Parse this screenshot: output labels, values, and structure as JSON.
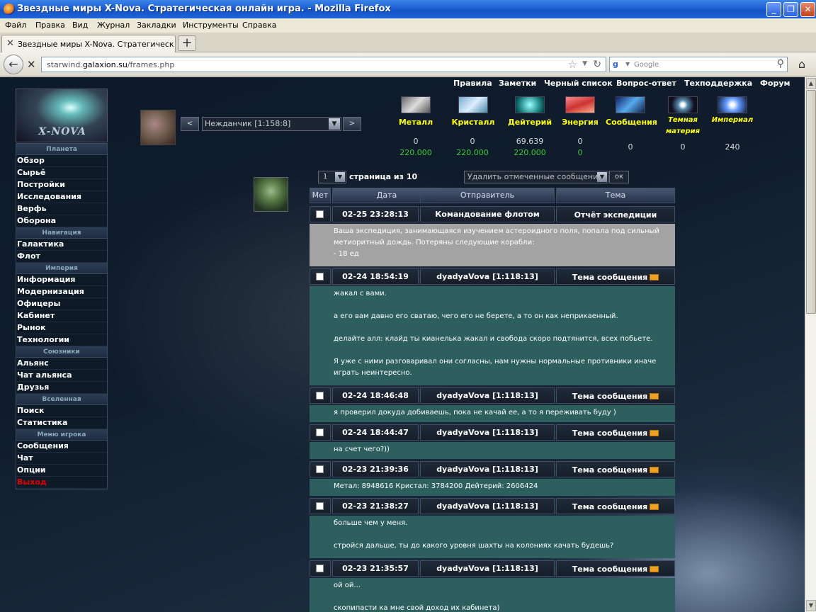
{
  "window": {
    "title": "Звездные миры X-Nova. Стратегическая онлайн игра. - Mozilla Firefox"
  },
  "menu": [
    "Файл",
    "Правка",
    "Вид",
    "Журнал",
    "Закладки",
    "Инструменты",
    "Справка"
  ],
  "tab": {
    "label": "Звездные миры X-Nova. Стратегическая ..."
  },
  "nav": {
    "url_prefix": "starwind.",
    "url_domain": "galaxion.su",
    "url_path": "/frames.php",
    "search_placeholder": "Google"
  },
  "toplinks": [
    "Правила",
    "Заметки",
    "Черный список",
    "Вопрос-ответ",
    "Техподдержка",
    "Форум"
  ],
  "planet": {
    "name": "Нежданчик [1:158:8]",
    "prev": "<",
    "next": ">"
  },
  "resources": [
    {
      "name": "Металл",
      "current": "0",
      "production": "220.000"
    },
    {
      "name": "Кристалл",
      "current": "0",
      "production": "220.000"
    },
    {
      "name": "Дейтерий",
      "current": "69.639",
      "production": "220.000"
    },
    {
      "name": "Энергия",
      "current": "0",
      "production": "0"
    },
    {
      "name": "Сообщения",
      "current": "0",
      "production": ""
    },
    {
      "name": "Темная материя",
      "current": "0",
      "production": ""
    },
    {
      "name": "Империал",
      "current": "240",
      "production": ""
    }
  ],
  "leftmenu": [
    {
      "type": "section",
      "label": "Планета"
    },
    {
      "type": "item",
      "label": "Обзор"
    },
    {
      "type": "item",
      "label": "Сырьё"
    },
    {
      "type": "item",
      "label": "Постройки"
    },
    {
      "type": "item",
      "label": "Исследования"
    },
    {
      "type": "item",
      "label": "Верфь"
    },
    {
      "type": "item",
      "label": "Оборона"
    },
    {
      "type": "section",
      "label": "Навигация"
    },
    {
      "type": "item",
      "label": "Галактика"
    },
    {
      "type": "item",
      "label": "Флот"
    },
    {
      "type": "section",
      "label": "Империя"
    },
    {
      "type": "item",
      "label": "Информация"
    },
    {
      "type": "item",
      "label": "Модернизация"
    },
    {
      "type": "item",
      "label": "Офицеры"
    },
    {
      "type": "item",
      "label": "Кабинет"
    },
    {
      "type": "item",
      "label": "Рынок"
    },
    {
      "type": "item",
      "label": "Технологии"
    },
    {
      "type": "section",
      "label": "Союзники"
    },
    {
      "type": "item",
      "label": "Альянс"
    },
    {
      "type": "item",
      "label": "Чат альянса"
    },
    {
      "type": "item",
      "label": "Друзья"
    },
    {
      "type": "section",
      "label": "Вселенная"
    },
    {
      "type": "item",
      "label": "Поиск"
    },
    {
      "type": "item",
      "label": "Статистика"
    },
    {
      "type": "section",
      "label": "Меню игрока"
    },
    {
      "type": "item",
      "label": "Сообщения"
    },
    {
      "type": "item",
      "label": "Чат"
    },
    {
      "type": "item",
      "label": "Опции"
    },
    {
      "type": "item",
      "label": "Выход",
      "color": "#e00000"
    }
  ],
  "messages_toolbar": {
    "page": "1",
    "page_text": "страница из 10",
    "delete_option": "Удалить отмеченные сообщения",
    "ok": "ок"
  },
  "columns": [
    "Мет",
    "Дата",
    "Отправитель",
    "Тема"
  ],
  "messages": [
    {
      "date": "02-25 23:28:13 +0400",
      "sender": "Командование флотом",
      "subject": "Отчёт экспедиции",
      "mail_icon": false,
      "gray": true,
      "lines": [
        "Ваша экспедиция, занимающаяся изучением астероидного поля, попала под сильный метиоритный дождь. Потеряны следующие корабли:",
        "- 18 ед"
      ]
    },
    {
      "date": "02-24 18:54:19 +0400",
      "sender": "dyadyaVova [1:118:13]",
      "subject": "Тема сообщения",
      "mail_icon": true,
      "gray": false,
      "lines": [
        "жакал с вами.",
        "",
        "а его вам давно его сватаю, чего его не берете, а то он как неприкаенный.",
        "",
        "делайте алл: клайд ты кианелька жакал и свобода скоро подтянится, всех побьете.",
        "",
        "Я уже с ними разговаривал они согласны, нам нужны нормальные противники иначе играть неинтересно."
      ]
    },
    {
      "date": "02-24 18:46:48 +0400",
      "sender": "dyadyaVova [1:118:13]",
      "subject": "Тема сообщения",
      "mail_icon": true,
      "gray": false,
      "lines": [
        "я проверил докуда добиваешь, пока не качай ее, а то я переживать буду )"
      ]
    },
    {
      "date": "02-24 18:44:47 +0400",
      "sender": "dyadyaVova [1:118:13]",
      "subject": "Тема сообщения",
      "mail_icon": true,
      "gray": false,
      "lines": [
        "на счет чего?))"
      ]
    },
    {
      "date": "02-23 21:39:36 +0400",
      "sender": "dyadyaVova [1:118:13]",
      "subject": "Тема сообщения",
      "mail_icon": true,
      "gray": false,
      "lines": [
        "Метал: 8948616 Кристал: 3784200 Дейтерий: 2606424"
      ]
    },
    {
      "date": "02-23 21:38:27 +0400",
      "sender": "dyadyaVova [1:118:13]",
      "subject": "Тема сообщения",
      "mail_icon": true,
      "gray": false,
      "lines": [
        "больше чем у меня.",
        "",
        "стройся дальше, ты до какого уровня шахты на колониях качать будешь?"
      ]
    },
    {
      "date": "02-23 21:35:57 +0400",
      "sender": "dyadyaVova [1:118:13]",
      "subject": "Тема сообщения",
      "mail_icon": true,
      "gray": false,
      "lines": [
        "ой ой...",
        "",
        "скопипасти ка мне свой доход их кабинета)"
      ]
    }
  ]
}
